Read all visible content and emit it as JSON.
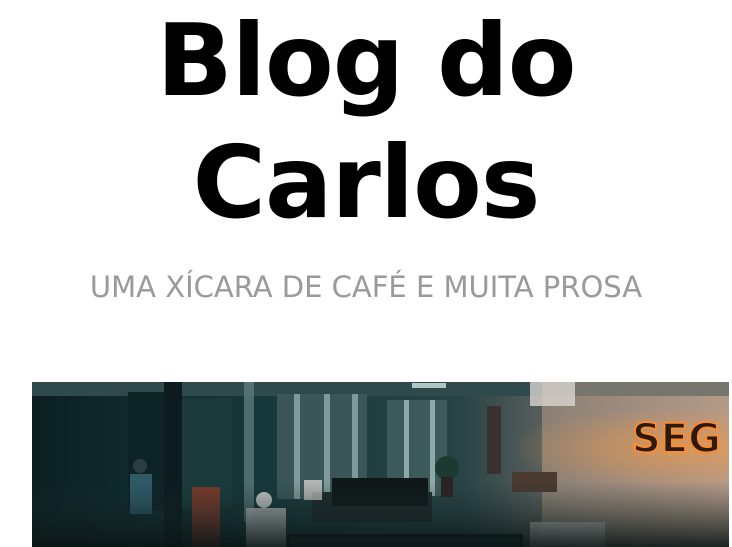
{
  "header": {
    "title_line1": "Blog do",
    "title_line2": "Carlos",
    "tagline": "UMA XÍCARA DE CAFÉ E MUITA PROSA"
  },
  "hero_image": {
    "neon_sign_text": "SEG"
  },
  "colors": {
    "title": "#000000",
    "tagline": "#9a9a9a",
    "background": "#ffffff",
    "neon": "#ff8a2a"
  }
}
